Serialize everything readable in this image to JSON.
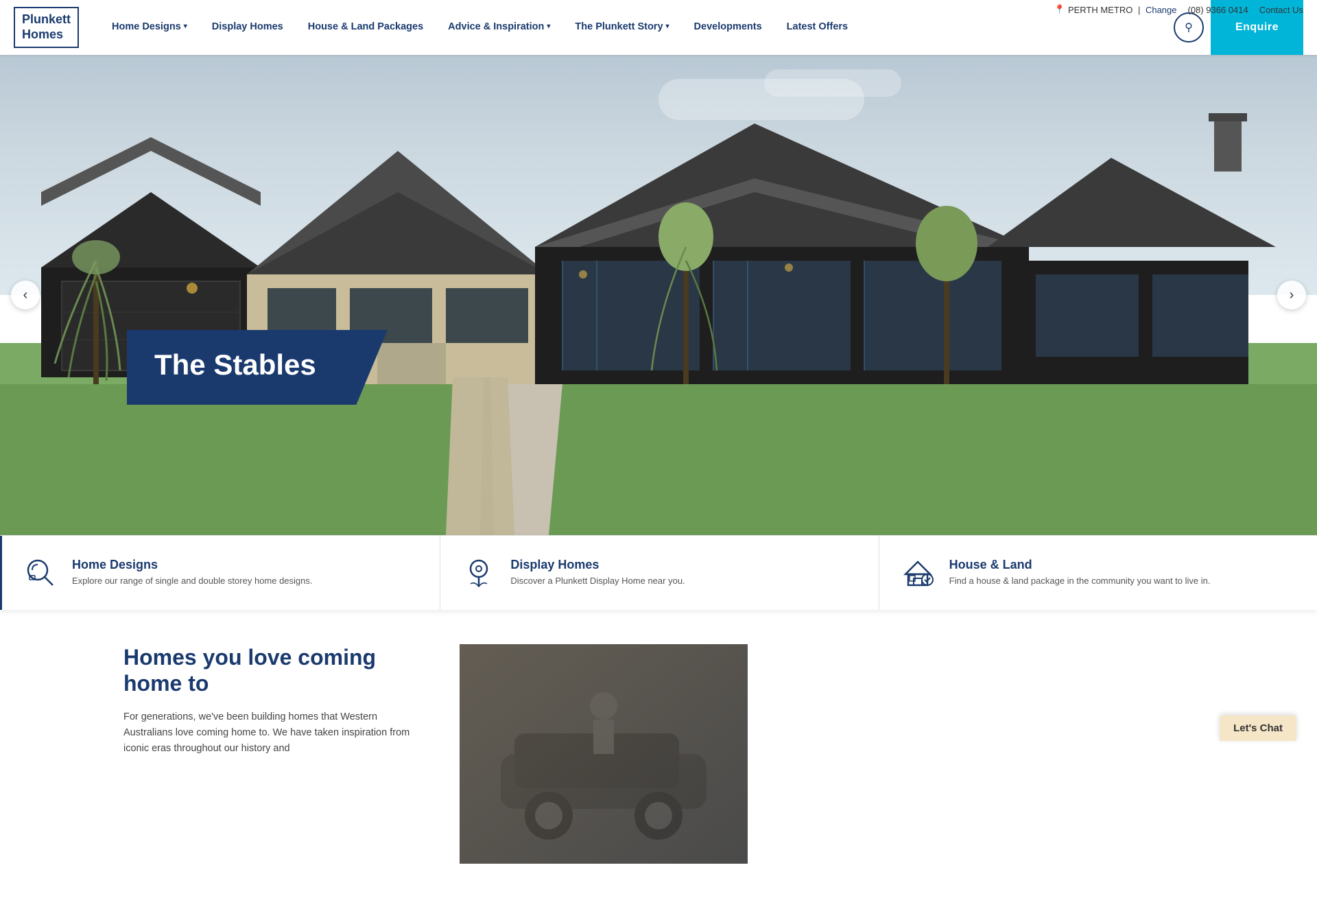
{
  "topbar": {
    "location": "PERTH METRO",
    "change_label": "Change",
    "phone": "(08) 9366 0414",
    "contact_label": "Contact Us"
  },
  "logo": {
    "line1": "Plunkett",
    "line2": "Homes"
  },
  "nav": {
    "items": [
      {
        "label": "Home Designs",
        "has_dropdown": true
      },
      {
        "label": "Display Homes",
        "has_dropdown": false
      },
      {
        "label": "House & Land Packages",
        "has_dropdown": false
      },
      {
        "label": "Advice & Inspiration",
        "has_dropdown": true
      },
      {
        "label": "The Plunkett Story",
        "has_dropdown": true
      },
      {
        "label": "Developments",
        "has_dropdown": false
      },
      {
        "label": "Latest Offers",
        "has_dropdown": false
      }
    ],
    "enquire_label": "Enquire"
  },
  "hero": {
    "title": "The Stables",
    "prev_label": "‹",
    "next_label": "›"
  },
  "quick_links": [
    {
      "id": "home-designs",
      "title": "Home Designs",
      "description": "Explore our range of single and double storey home designs.",
      "icon": "search"
    },
    {
      "id": "display-homes",
      "title": "Display Homes",
      "description": "Discover a Plunkett Display Home near you.",
      "icon": "pin"
    },
    {
      "id": "house-land",
      "title": "House & Land",
      "description": "Find a house & land package in the community you want to live in.",
      "icon": "house"
    }
  ],
  "section": {
    "heading": "Homes you love coming home to",
    "description": "For generations, we've been building homes that Western Australians love coming home to. We have taken inspiration from iconic eras throughout our history and"
  },
  "lets_chat": {
    "label": "Let's Chat"
  }
}
